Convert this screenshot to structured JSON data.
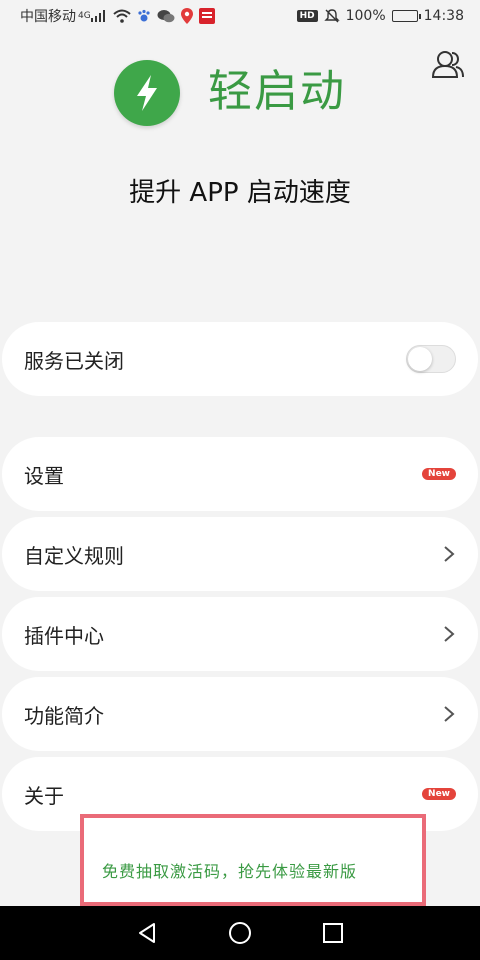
{
  "status_bar": {
    "carrier": "中国移动",
    "network_type": "4G",
    "hd": "HD",
    "battery": "100%",
    "time": "14:38"
  },
  "header": {
    "title": "轻启动",
    "subtitle": "提升 APP 启动速度",
    "logo_icon": "lightning-icon",
    "user_icon": "users-icon"
  },
  "service": {
    "label": "服务已关闭",
    "enabled": false
  },
  "menu": {
    "items": [
      {
        "label": "设置",
        "badge": "New"
      },
      {
        "label": "自定义规则"
      },
      {
        "label": "插件中心"
      },
      {
        "label": "功能简介"
      },
      {
        "label": "关于",
        "badge": "New"
      }
    ]
  },
  "promo": {
    "text": "免费抽取激活码，抢先体验最新版"
  },
  "colors": {
    "accent": "#3a9a43",
    "badge": "#e4443b",
    "promo_border": "#ea6b78"
  }
}
